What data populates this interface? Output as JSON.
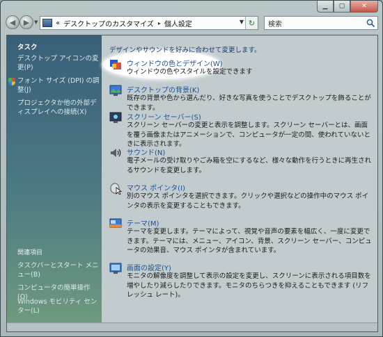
{
  "address": {
    "overflow": "«",
    "segments": [
      "デスクトップのカスタマイズ",
      "個人設定"
    ],
    "separator": "▸"
  },
  "search": {
    "placeholder": "検索"
  },
  "sidebar": {
    "tasks_heading": "タスク",
    "tasks": [
      "デスクトップ アイコンの変更(P)",
      "フォント サイズ (DPI) の調整(J)",
      "プロジェクタか他の外部ディスプレイへの接続(X)"
    ],
    "related_heading": "関連項目",
    "related": [
      "タスクバーとスタート メニュー(B)",
      "コンピュータの簡単操作(O)",
      "Windows モビリティ センター(L)"
    ]
  },
  "main": {
    "intro": "デザインやサウンドを好みに合わせて変更します。",
    "items": [
      {
        "title": "ウィンドウの色とデザイン(W)",
        "desc": "ウィンドウの色やスタイルを設定できます",
        "icon": "window-color-icon"
      },
      {
        "title": "デスクトップの背景(K)",
        "desc": "既存の背景や色から選んだり、好きな写真を使うことでデスクトップを飾ることができます。",
        "icon": "desktop-background-icon"
      },
      {
        "title": "スクリーン セーバー(S)",
        "desc": "スクリーン セーバーの変更と表示を調整します。スクリーン セーバーとは、画面を覆う画像またはアニメーションで、コンピュータが一定の間、使われていないときに表示されます。",
        "icon": "screensaver-icon"
      },
      {
        "title": "サウンド(N)",
        "desc": "電子メールの受け取りやごみ箱を空にするなど、様々な動作を行うときに再生されるサウンドを変更します。",
        "icon": "sound-icon"
      },
      {
        "title": "マウス ポインタ(I)",
        "desc": "別のマウス ポインタを選択できます。クリックや選択などの操作中のマウス ポインタの表示を変更することもできます。",
        "icon": "mouse-pointer-icon"
      },
      {
        "title": "テーマ(M)",
        "desc": "テーマを変更します。テーマによって、視覚や音声の要素を幅広く、一度に変更できます。テーマには、メニュー、アイコン、背景、スクリーン セーバー、コンピュータの効果音、マウス ポインタが含まれています。",
        "icon": "theme-icon"
      },
      {
        "title": "画面の設定(Y)",
        "desc": "モニタの解像度を調整して表示の設定を変更し、スクリーンに表示される項目数を増やしたり減らしたりできます。モニタのちらつきを抑えることもできます (リフレッシュ レート)。",
        "icon": "display-settings-icon"
      }
    ]
  },
  "colors": {
    "link": "#1a4f96",
    "sidebar_top": "#385f78",
    "sidebar_bottom": "#6e9a7e"
  }
}
